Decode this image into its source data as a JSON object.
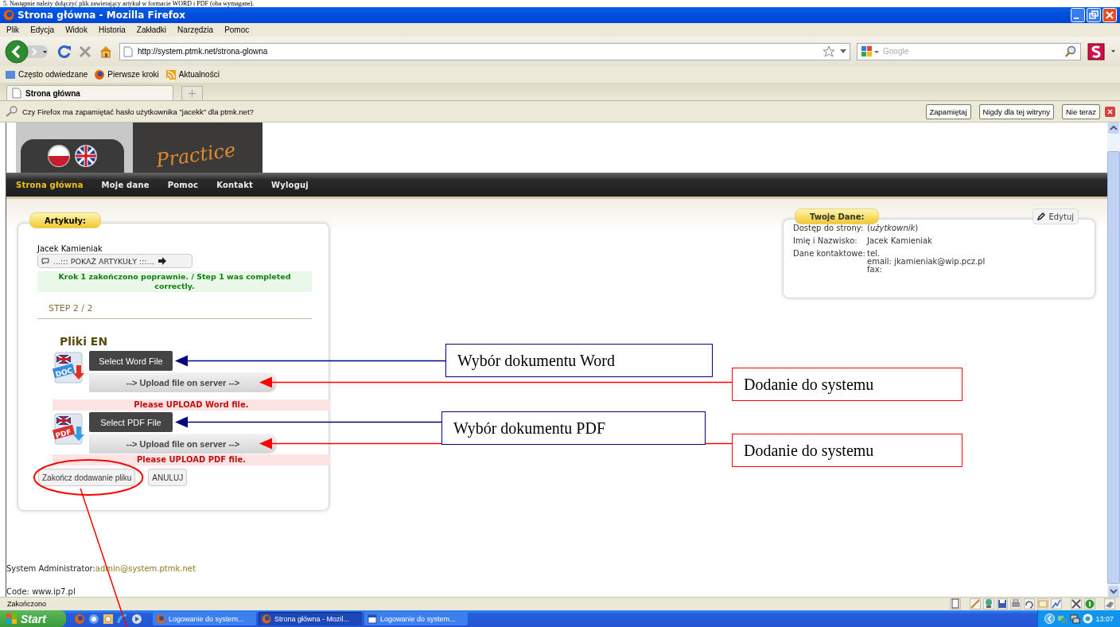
{
  "document_text": "5. Następnie należy dołączyć plik zawierający artykuł w formacie WORD i PDF (oba wymagane).",
  "window": {
    "title": "Strona główna - Mozilla Firefox"
  },
  "menu": [
    "Plik",
    "Edycja",
    "Widok",
    "Historia",
    "Zakładki",
    "Narzędzia",
    "Pomoc"
  ],
  "toolbar": {
    "url": "http://system.ptmk.net/strona-glowna",
    "search_placeholder": "Google"
  },
  "bookmarks": [
    "Często odwiedzane",
    "Pierwsze kroki",
    "Aktualności"
  ],
  "tabs": [
    {
      "label": "Strona główna",
      "selected": true
    }
  ],
  "password_bar": {
    "message": "Czy Firefox ma zapamiętać hasło użytkownika \"jacekk\" dla ptmk.net?",
    "buttons": [
      "Zapamiętaj",
      "Nigdy dla tej witryny",
      "Nie teraz"
    ]
  },
  "site": {
    "logo_text": "Practice",
    "nav": [
      {
        "label": "Strona główna",
        "selected": true
      },
      {
        "label": "Moje dane",
        "selected": false
      },
      {
        "label": "Pomoc",
        "selected": false
      },
      {
        "label": "Kontakt",
        "selected": false
      },
      {
        "label": "Wyloguj",
        "selected": false
      }
    ],
    "articles": {
      "title": "Artykuły:",
      "author": "Jacek Kamieniak",
      "show_button": "...::: POKAŻ ARTYKUŁY :::...",
      "success": "Krok 1 zakończono poprawnie. / Step 1 was completed correctly.",
      "step": "STEP 2 / 2",
      "section": "Pliki EN",
      "files": [
        {
          "badge": "DOC",
          "select": "Select Word File",
          "upload": "--> Upload file on server -->",
          "warning": "Please UPLOAD Word file."
        },
        {
          "badge": "PDF",
          "select": "Select PDF File",
          "upload": "--> Upload file on server -->",
          "warning": "Please UPLOAD PDF file."
        }
      ],
      "finish": "Zakończ dodawanie pliku",
      "cancel": "ANULUJ"
    },
    "user": {
      "title": "Twoje Dane:",
      "edit": "Edytuj",
      "rows": [
        {
          "label": "Dostęp do strony:",
          "lines": [
            "(*użytkownik*)"
          ]
        },
        {
          "label": "Imię i Nazwisko:",
          "lines": [
            "Jacek Kamieniak"
          ]
        },
        {
          "label": "Dane kontaktowe:",
          "lines": [
            "tel.",
            "email: jkamieniak@wip.pcz.pl",
            "fax:"
          ]
        }
      ]
    },
    "footer": {
      "admin_label": "System Administrator:",
      "admin_email": "admin@system.ptmk.net",
      "code": "Code: www.ip7.pl"
    }
  },
  "status_bar": "Zakończono",
  "taskbar": {
    "start": "Start",
    "tasks": [
      {
        "label": "Logowanie do system...",
        "selected": false
      },
      {
        "label": "Strona główna - Mozil...",
        "selected": true
      },
      {
        "label": "Logowanie do system...",
        "selected": false
      }
    ],
    "clock": "13:07"
  },
  "annotations": [
    {
      "kind": "callout",
      "text": "Wybór dokumentu Word",
      "color": "#000080"
    },
    {
      "kind": "callout",
      "text": "Dodanie do systemu",
      "color": "#ff0000"
    },
    {
      "kind": "callout",
      "text": "Wybór dokumentu PDF",
      "color": "#000080"
    },
    {
      "kind": "callout",
      "text": "Dodanie do systemu",
      "color": "#ff0000"
    },
    {
      "kind": "circle",
      "color": "#ff0000"
    }
  ]
}
